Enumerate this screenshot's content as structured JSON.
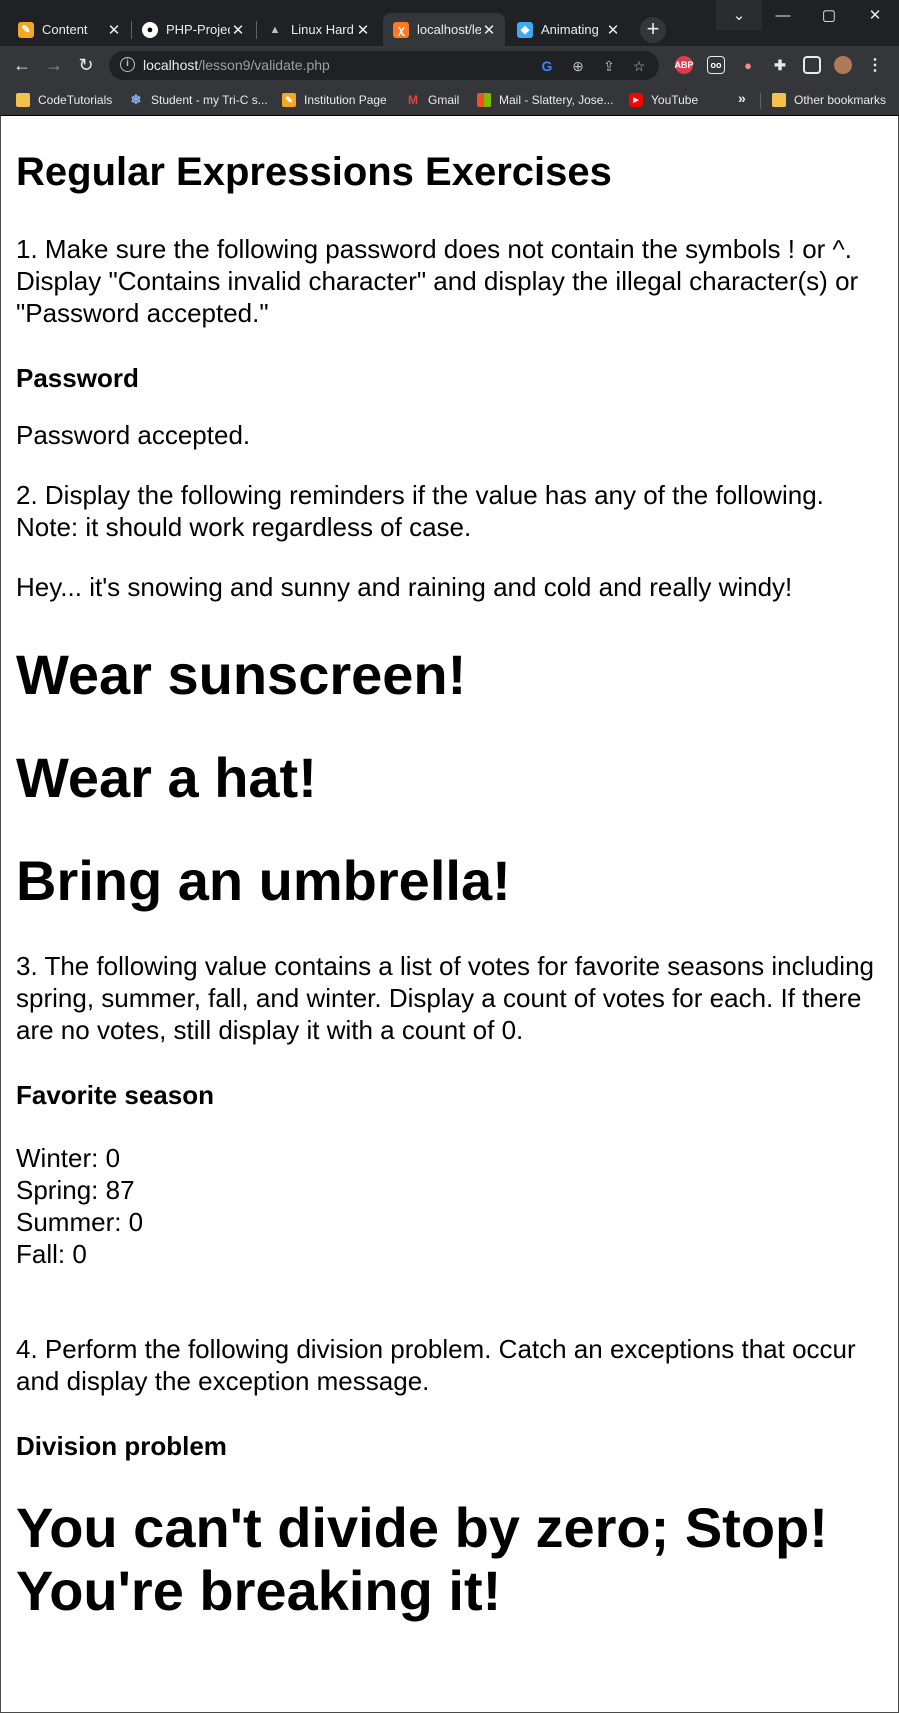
{
  "browser": {
    "tabs": [
      {
        "label": "Content",
        "icon": "pencil-icon",
        "color": "#f5a623"
      },
      {
        "label": "PHP-Projec",
        "icon": "github-icon",
        "color": "#ffffff"
      },
      {
        "label": "Linux Hard",
        "icon": "linux-icon",
        "color": "#5f6368"
      },
      {
        "label": "localhost/le",
        "icon": "xampp-icon",
        "color": "#fb7a24",
        "active": true
      },
      {
        "label": "Animating",
        "icon": "codepen-icon",
        "color": "#3fa9f5"
      }
    ],
    "url": {
      "host": "localhost",
      "path": "/lesson9/validate.php"
    },
    "bookmarks": [
      {
        "label": "CodeTutorials",
        "icon": "folder-icon"
      },
      {
        "label": "Student - my Tri-C s...",
        "icon": "snowflake-icon"
      },
      {
        "label": "Institution Page",
        "icon": "pencil-icon"
      },
      {
        "label": "Gmail",
        "icon": "gmail-icon"
      },
      {
        "label": "Mail - Slattery, Jose...",
        "icon": "microsoft-icon"
      },
      {
        "label": "YouTube",
        "icon": "youtube-icon"
      }
    ],
    "other_bookmarks": "Other bookmarks",
    "more_bookmarks": "»",
    "extensions": {
      "abp": "ABP"
    }
  },
  "page": {
    "title": "Regular Expressions Exercises",
    "q1": {
      "text": "1. Make sure the following password does not contain the symbols ! or ^. Display \"Contains invalid character\" and display the illegal character(s) or \"Password accepted.\"",
      "heading": "Password",
      "result": "Password accepted."
    },
    "q2": {
      "text": "2. Display the following reminders if the value has any of the following. Note: it should work regardless of case.",
      "value": "Hey... it's snowing and sunny and raining and cold and really windy!",
      "reminders": [
        "Wear sunscreen!",
        "Wear a hat!",
        "Bring an umbrella!"
      ]
    },
    "q3": {
      "text": "3. The following value contains a list of votes for favorite seasons including spring, summer, fall, and winter. Display a count of votes for each. If there are no votes, still display it with a count of 0.",
      "heading": "Favorite season",
      "counts": [
        "Winter: 0",
        "Spring: 87",
        "Summer: 0",
        "Fall: 0"
      ]
    },
    "q4": {
      "text": "4. Perform the following division problem. Catch an exceptions that occur and display the exception message.",
      "heading": "Division problem",
      "message_line1": "You can't divide by zero; Stop!",
      "message_line2": "You're breaking it!"
    }
  }
}
